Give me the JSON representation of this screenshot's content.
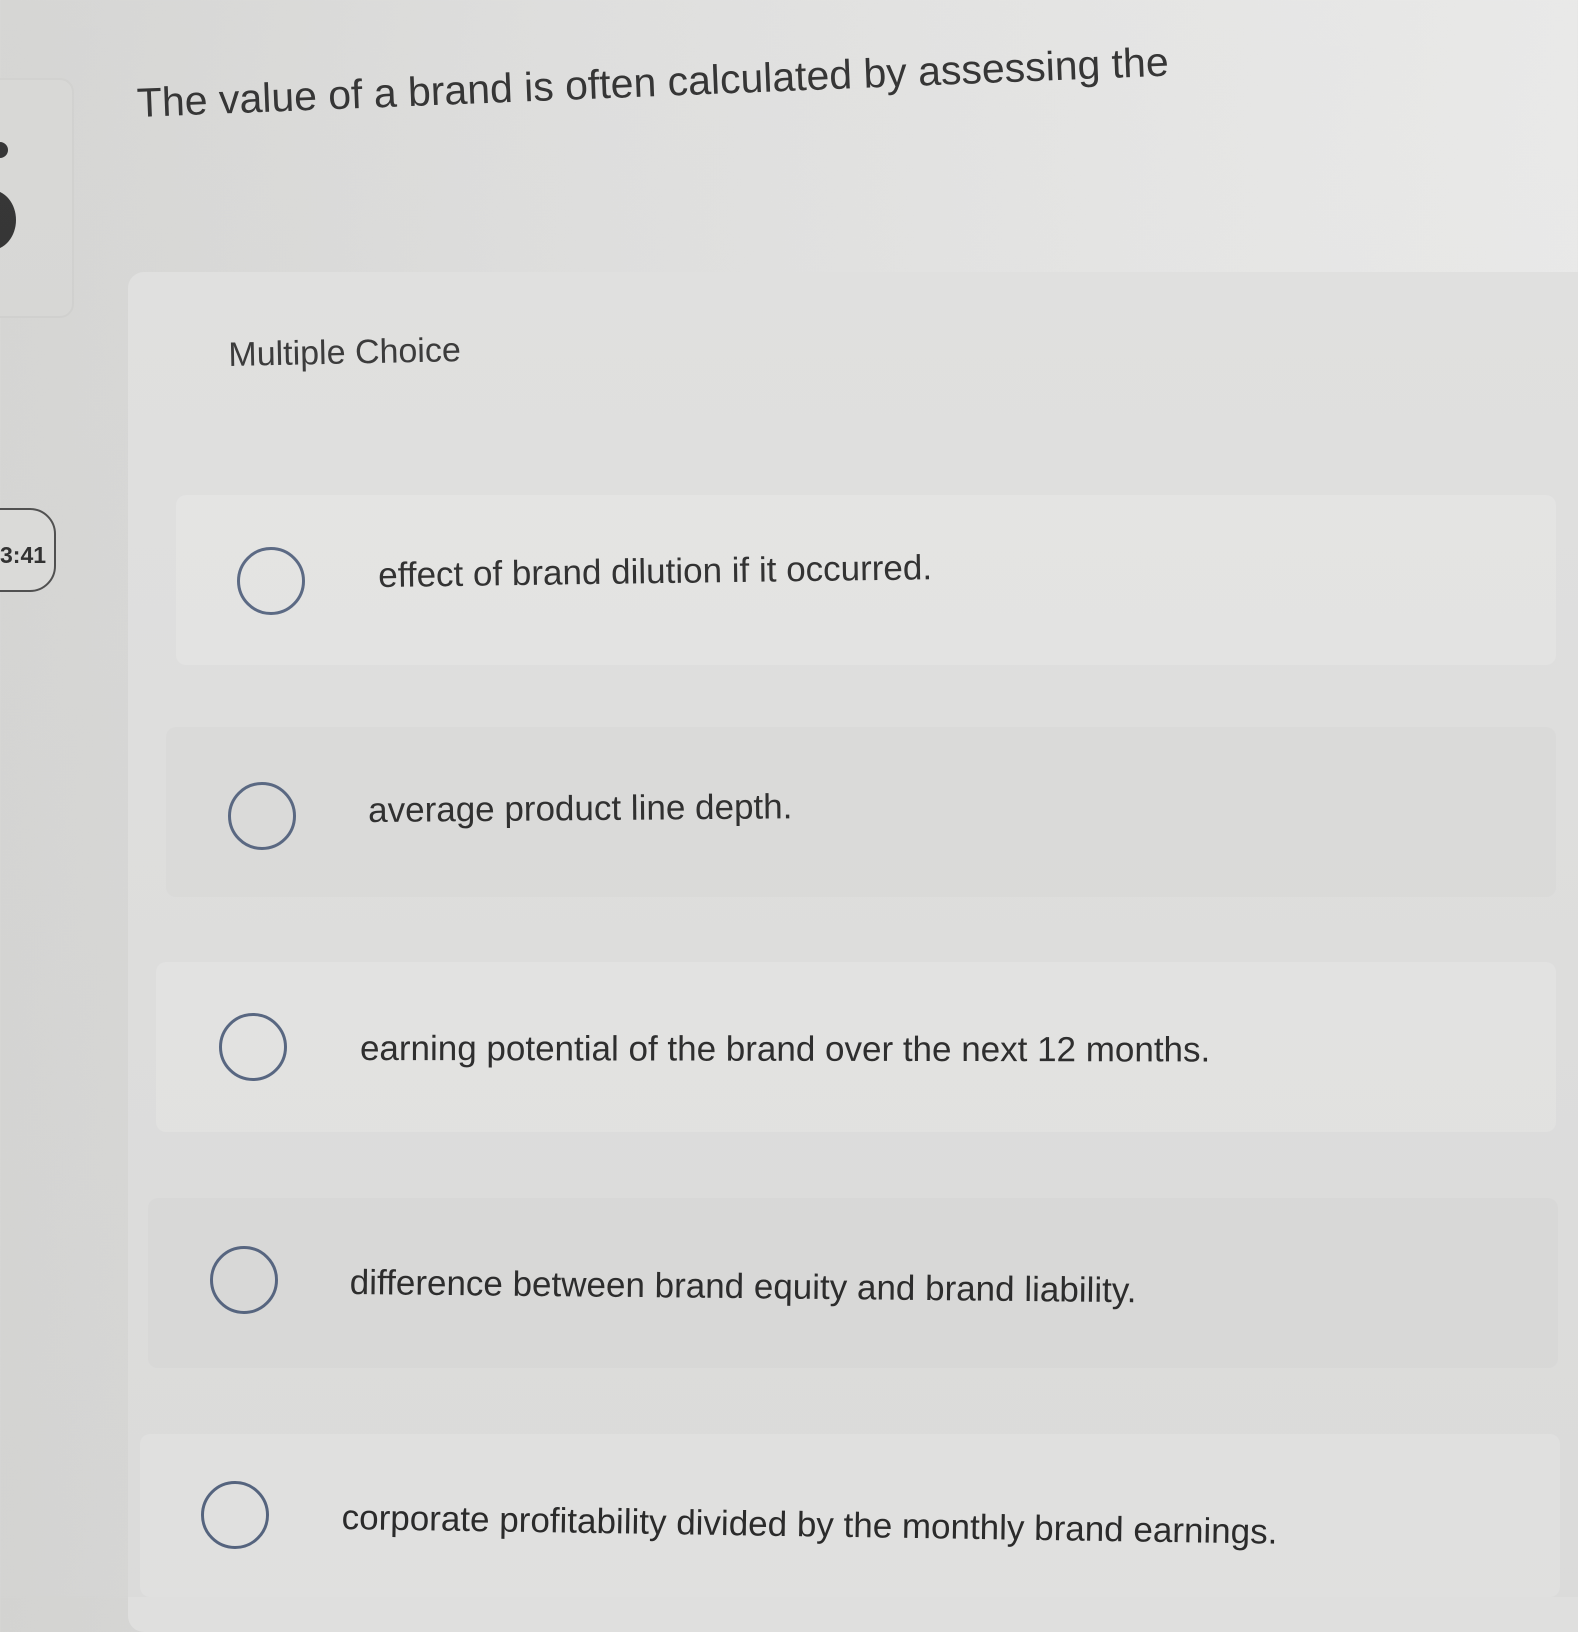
{
  "timer": {
    "text": "3:41"
  },
  "question": {
    "text": "The value of a brand is often calculated by assessing the"
  },
  "section": {
    "label": "Multiple Choice"
  },
  "options": [
    {
      "label": "effect of brand dilution if it occurred."
    },
    {
      "label": "average product line depth."
    },
    {
      "label": "earning potential of the brand over the next 12 months."
    },
    {
      "label": "difference between brand equity and brand liability."
    },
    {
      "label": "corporate profitability divided by the monthly brand earnings."
    }
  ],
  "colors": {
    "radio_border": "#566580",
    "text": "#2b2b2b",
    "background": "#dcdcdb"
  }
}
